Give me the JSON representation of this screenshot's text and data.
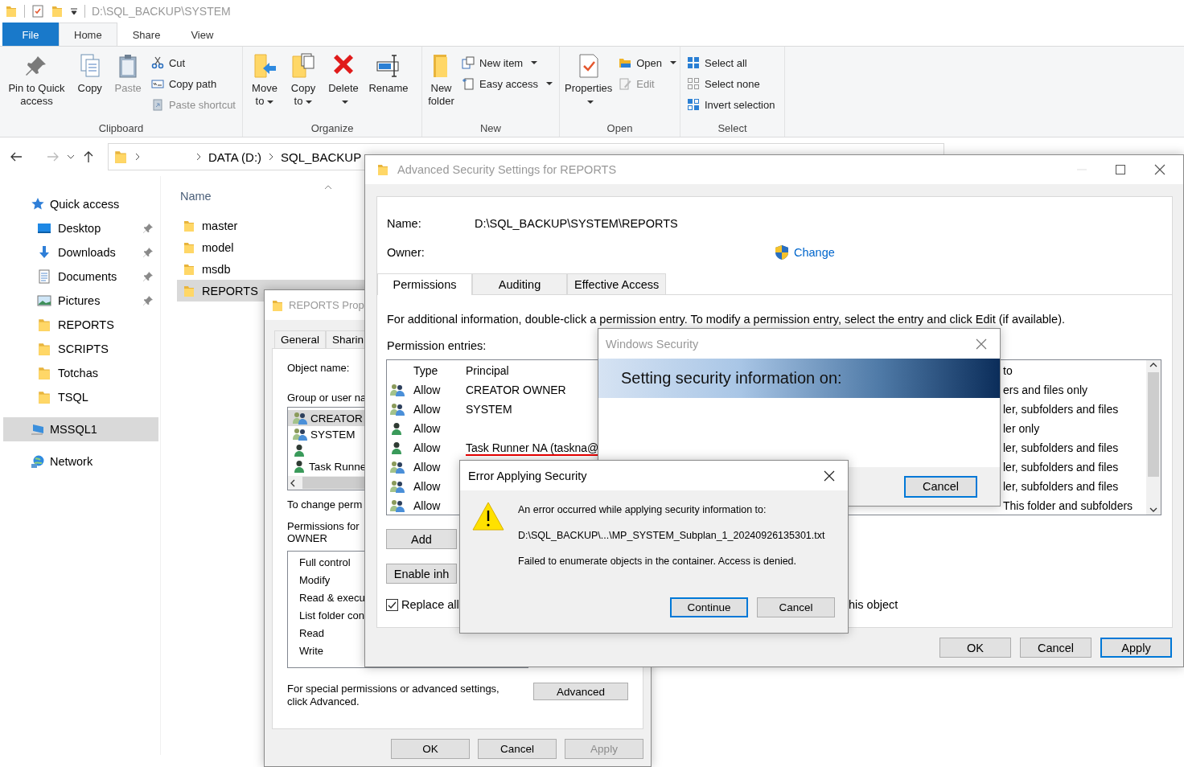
{
  "explorer": {
    "title": "D:\\SQL_BACKUP\\SYSTEM",
    "ribbon_tabs": [
      {
        "label": "File",
        "kind": "menu",
        "selected": false
      },
      {
        "label": "Home",
        "kind": "tab",
        "selected": true
      },
      {
        "label": "Share",
        "kind": "tab",
        "selected": false
      },
      {
        "label": "View",
        "kind": "tab",
        "selected": false
      }
    ],
    "ribbon_groups": [
      {
        "label": "Clipboard",
        "items": [
          {
            "label": "Pin to Quick access",
            "kind": "large",
            "disabled": false,
            "dropdown": false
          },
          {
            "label": "Copy",
            "kind": "large",
            "disabled": false,
            "dropdown": false
          },
          {
            "label": "Paste",
            "kind": "large",
            "disabled": true,
            "dropdown": false
          },
          {
            "label": "Cut",
            "kind": "small",
            "disabled": false,
            "dropdown": false
          },
          {
            "label": "Copy path",
            "kind": "small",
            "disabled": false,
            "dropdown": false
          },
          {
            "label": "Paste shortcut",
            "kind": "small",
            "disabled": true,
            "dropdown": false
          }
        ]
      },
      {
        "label": "Organize",
        "items": [
          {
            "label": "Move to",
            "kind": "large",
            "disabled": false,
            "dropdown": true
          },
          {
            "label": "Copy to",
            "kind": "large",
            "disabled": false,
            "dropdown": true
          },
          {
            "label": "Delete",
            "kind": "large",
            "disabled": false,
            "dropdown": true
          },
          {
            "label": "Rename",
            "kind": "large",
            "disabled": false,
            "dropdown": false
          }
        ]
      },
      {
        "label": "New",
        "items": [
          {
            "label": "New folder",
            "kind": "large",
            "disabled": false,
            "dropdown": false
          },
          {
            "label": "New item",
            "kind": "small",
            "disabled": false,
            "dropdown": true
          },
          {
            "label": "Easy access",
            "kind": "small",
            "disabled": false,
            "dropdown": true
          }
        ]
      },
      {
        "label": "Open",
        "items": [
          {
            "label": "Properties",
            "kind": "large",
            "disabled": false,
            "dropdown": true
          },
          {
            "label": "Open",
            "kind": "small",
            "disabled": false,
            "dropdown": true
          },
          {
            "label": "Edit",
            "kind": "small",
            "disabled": true,
            "dropdown": false
          }
        ]
      },
      {
        "label": "Select",
        "items": [
          {
            "label": "Select all",
            "kind": "small",
            "disabled": false,
            "dropdown": false
          },
          {
            "label": "Select none",
            "kind": "small",
            "disabled": false,
            "dropdown": false
          },
          {
            "label": "Invert selection",
            "kind": "small",
            "disabled": false,
            "dropdown": false
          }
        ]
      }
    ],
    "breadcrumbs": [
      "DATA (D:)",
      "SQL_BACKUP"
    ],
    "navigation": [
      {
        "label": "Quick access",
        "selected": false,
        "children": [
          {
            "label": "Desktop",
            "pinned": true,
            "selected": false
          },
          {
            "label": "Downloads",
            "pinned": true,
            "selected": false
          },
          {
            "label": "Documents",
            "pinned": true,
            "selected": false
          },
          {
            "label": "Pictures",
            "pinned": true,
            "selected": false
          },
          {
            "label": "REPORTS",
            "pinned": false,
            "selected": false
          },
          {
            "label": "SCRIPTS",
            "pinned": false,
            "selected": false
          },
          {
            "label": "Totchas",
            "pinned": false,
            "selected": false
          },
          {
            "label": "TSQL",
            "pinned": false,
            "selected": false
          }
        ]
      },
      {
        "label": "MSSQL1",
        "selected": true
      },
      {
        "label": "Network",
        "selected": false
      }
    ],
    "file_list": {
      "column": "Name",
      "rows": [
        {
          "name": "master",
          "selected": false
        },
        {
          "name": "model",
          "selected": false
        },
        {
          "name": "msdb",
          "selected": false
        },
        {
          "name": "REPORTS",
          "selected": true
        }
      ]
    }
  },
  "properties_dialog": {
    "title": "REPORTS Prop",
    "tabs": [
      {
        "label": "General",
        "selected": false
      },
      {
        "label": "Sharin",
        "selected": false
      }
    ],
    "object_name_label": "Object name:",
    "group_label": "Group or user na",
    "principals": [
      {
        "name": "CREATOR",
        "kind": "group",
        "selected": true
      },
      {
        "name": "SYSTEM",
        "kind": "group",
        "selected": false
      },
      {
        "kind": "user",
        "selected": false
      },
      {
        "name": "Task Runne",
        "kind": "user",
        "selected": false
      }
    ],
    "change_hint": "To change perm",
    "permissions_for": [
      "Permissions for",
      "OWNER"
    ],
    "permissions": [
      "Full control",
      "Modify",
      "Read & execu",
      "List folder con",
      "Read",
      "Write"
    ],
    "advanced_hint": "For special permissions or advanced settings, click Advanced.",
    "advanced_button": "Advanced",
    "buttons": [
      {
        "label": "OK",
        "default": false,
        "disabled": false
      },
      {
        "label": "Cancel",
        "default": false,
        "disabled": false
      },
      {
        "label": "Apply",
        "default": false,
        "disabled": true
      }
    ]
  },
  "advanced_dialog": {
    "title": "Advanced Security Settings for REPORTS",
    "name_label": "Name:",
    "name_value": "D:\\SQL_BACKUP\\SYSTEM\\REPORTS",
    "owner_label": "Owner:",
    "change_link": "Change",
    "tabs": [
      {
        "label": "Permissions",
        "selected": true
      },
      {
        "label": "Auditing",
        "selected": false
      },
      {
        "label": "Effective Access",
        "selected": false
      }
    ],
    "info": "For additional information, double-click a permission entry. To modify a permission entry, select the entry and click Edit (if available).",
    "entries_label": "Permission entries:",
    "table": {
      "columns": [
        "Type",
        "Principal",
        "to"
      ],
      "rows": [
        {
          "kind": "group",
          "type": "Allow",
          "principal": "CREATOR OWNER",
          "applies_to": "ers and files only",
          "underlined": false
        },
        {
          "kind": "group",
          "type": "Allow",
          "principal": "SYSTEM",
          "applies_to": "ler, subfolders and files",
          "underlined": false
        },
        {
          "kind": "user",
          "type": "Allow",
          "applies_to": "ler only"
        },
        {
          "kind": "user",
          "type": "Allow",
          "principal": "Task Runner NA (taskna@",
          "applies_to": "ler, subfolders and files",
          "underlined": true
        },
        {
          "kind": "group",
          "type": "Allow",
          "applies_to": "ler, subfolders and files"
        },
        {
          "kind": "group",
          "type": "Allow",
          "applies_to": "ler, subfolders and files"
        },
        {
          "kind": "group",
          "type": "Allow",
          "applies_to": "This folder and subfolders"
        }
      ]
    },
    "add_button": "Add",
    "inherit_button": "Enable inh",
    "replace_checkbox": {
      "label": "Replace all",
      "checked": true
    },
    "replace_tail": "his object",
    "buttons": [
      {
        "label": "OK",
        "default": false,
        "disabled": false
      },
      {
        "label": "Cancel",
        "default": false,
        "disabled": false
      },
      {
        "label": "Apply",
        "default": true,
        "disabled": false
      }
    ]
  },
  "progress_dialog": {
    "title": "Windows Security",
    "heading": "Setting security information on:",
    "buttons": [
      {
        "label": "Cancel",
        "default": true,
        "disabled": false
      }
    ]
  },
  "error_dialog": {
    "title": "Error Applying Security",
    "messages": [
      "An error occurred while applying security information to:",
      "D:\\SQL_BACKUP\\...\\MP_SYSTEM_Subplan_1_20240926135301.txt",
      "Failed to enumerate objects in the container. Access is denied."
    ],
    "buttons": [
      {
        "label": "Continue",
        "default": true,
        "disabled": false
      },
      {
        "label": "Cancel",
        "default": false,
        "disabled": false
      }
    ]
  }
}
